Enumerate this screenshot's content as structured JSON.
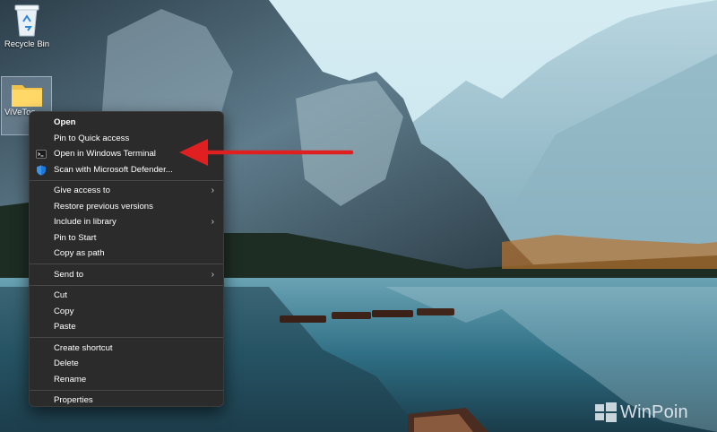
{
  "desktop": {
    "icons": [
      {
        "label": "Recycle Bin",
        "icon": "recycle-bin-icon"
      },
      {
        "label": "ViVeToo",
        "icon": "folder-icon"
      }
    ]
  },
  "context_menu": {
    "groups": [
      [
        {
          "label": "Open",
          "bold": true
        },
        {
          "label": "Pin to Quick access"
        },
        {
          "label": "Open in Windows Terminal",
          "icon": "terminal-icon"
        },
        {
          "label": "Scan with Microsoft Defender...",
          "icon": "defender-shield-icon"
        }
      ],
      [
        {
          "label": "Give access to",
          "submenu": true
        },
        {
          "label": "Restore previous versions"
        },
        {
          "label": "Include in library",
          "submenu": true
        },
        {
          "label": "Pin to Start"
        },
        {
          "label": "Copy as path"
        }
      ],
      [
        {
          "label": "Send to",
          "submenu": true
        }
      ],
      [
        {
          "label": "Cut"
        },
        {
          "label": "Copy"
        },
        {
          "label": "Paste"
        }
      ],
      [
        {
          "label": "Create shortcut"
        },
        {
          "label": "Delete"
        },
        {
          "label": "Rename"
        }
      ],
      [
        {
          "label": "Properties"
        }
      ]
    ]
  },
  "annotation": {
    "color": "#e02020",
    "points_to": "Open in Windows Terminal"
  },
  "watermark": {
    "text": "WinPoin"
  },
  "colors": {
    "menu_bg": "#2b2b2b",
    "menu_text": "#ffffff",
    "separator": "#484848",
    "defender_blue": "#1e78d6"
  }
}
